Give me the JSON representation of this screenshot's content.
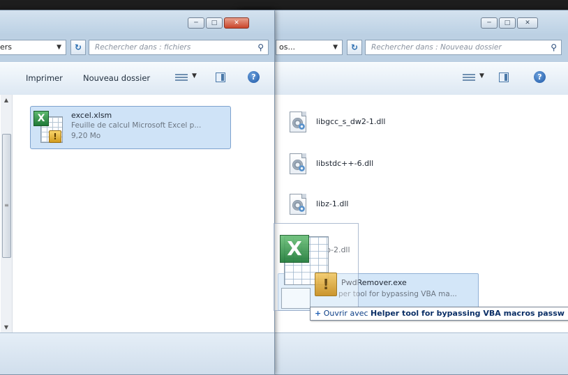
{
  "right_window": {
    "address_text": "os...",
    "search_placeholder": "Rechercher dans : Nouveau dossier",
    "files": [
      {
        "name": "libgcc_s_dw2-1.dll"
      },
      {
        "name": "libstdc++-6.dll"
      },
      {
        "name": "libz-1.dll"
      },
      {
        "name": "p-2.dll"
      }
    ],
    "exe": {
      "name": "PwdRemover.exe",
      "desc": "per tool for bypassing VBA ma..."
    }
  },
  "left_window": {
    "address_text": "ers",
    "search_placeholder": "Rechercher dans : fichiers",
    "toolbar": {
      "print_label": "Imprimer",
      "new_folder_label": "Nouveau dossier"
    },
    "file": {
      "name": "excel.xlsm",
      "type": "Feuille de calcul Microsoft Excel p...",
      "size": "9,20 Mo"
    }
  },
  "drag_tooltip": {
    "plus": "+",
    "prefix": "Ouvrir avec",
    "target": "Helper tool for bypassing VBA macros passw"
  },
  "icons": {
    "refresh": "refresh-icon",
    "search": "search-icon",
    "help": "help-icon",
    "view": "view-options-icon",
    "preview_pane": "preview-pane-icon"
  }
}
